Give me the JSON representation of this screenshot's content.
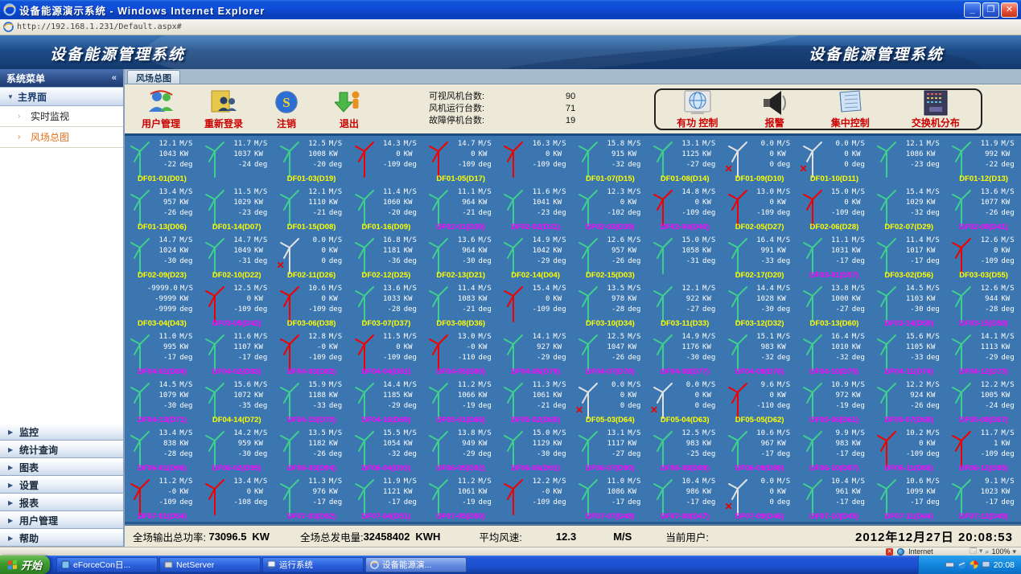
{
  "window": {
    "title": "设备能源演示系统 - Windows Internet Explorer",
    "url": "http://192.168.1.231/Default.aspx#",
    "min_label": "_",
    "restore_label": "❐",
    "close_label": "✕"
  },
  "banner": {
    "title_left": "设备能源管理系统",
    "title_right": "设备能源管理系统"
  },
  "sidebar": {
    "header": "系统菜单",
    "collapse_glyph": "«",
    "main_group": "主界面",
    "sub_items": [
      {
        "label": "实时监视",
        "active": false
      },
      {
        "label": "风场总图",
        "active": true
      }
    ],
    "bottom_items": [
      "监控",
      "统计查询",
      "图表",
      "设置",
      "报表",
      "用户管理",
      "帮助"
    ]
  },
  "tab": "风场总图",
  "toolbar": {
    "buttons": [
      {
        "label": "用户管理",
        "icon": "user-management-icon"
      },
      {
        "label": "重新登录",
        "icon": "relogin-icon"
      },
      {
        "label": "注销",
        "icon": "logoff-icon"
      },
      {
        "label": "退出",
        "icon": "exit-icon"
      }
    ],
    "stats": [
      {
        "label": "可视风机台数:",
        "value": "90"
      },
      {
        "label": "风机运行台数:",
        "value": "71"
      },
      {
        "label": "故障停机台数:",
        "value": "19"
      }
    ],
    "controls": [
      {
        "label": "有功 控制",
        "icon": "active-power-control-icon"
      },
      {
        "label": "报警",
        "icon": "alarm-icon"
      },
      {
        "label": "集中控制",
        "icon": "central-control-icon"
      },
      {
        "label": "交换机分布",
        "icon": "switch-distribution-icon"
      }
    ]
  },
  "turbines": {
    "units": {
      "speed": "M/S",
      "power": "KW",
      "angle": "deg"
    },
    "colors": {
      "run": "#3ecf8e",
      "fault": "#f20000",
      "stop": "#e2e2e2",
      "label_yellow": "#ffff00",
      "label_magenta": "#ff00ff"
    },
    "rows": [
      [
        {
          "s": "12.1",
          "p": "1043",
          "a": "-22",
          "l": "DF01-01(D01)",
          "st": "g",
          "lc": "y"
        },
        {
          "s": "11.7",
          "p": "1037",
          "a": "-24",
          "l": "",
          "st": "g",
          "lc": "h"
        },
        {
          "s": "12.5",
          "p": "1008",
          "a": "-20",
          "l": "DF01-03(D19)",
          "st": "g",
          "lc": "y"
        },
        {
          "s": "14.3",
          "p": "0",
          "a": "-109",
          "l": "",
          "st": "r",
          "lc": "h"
        },
        {
          "s": "14.7",
          "p": "0",
          "a": "-109",
          "l": "DF01-05(D17)",
          "st": "r",
          "lc": "y"
        },
        {
          "s": "16.3",
          "p": "0",
          "a": "-109",
          "l": "",
          "st": "r",
          "lc": "h"
        },
        {
          "s": "15.8",
          "p": "915",
          "a": "-32",
          "l": "DF01-07(D15)",
          "st": "g",
          "lc": "y"
        },
        {
          "s": "13.1",
          "p": "1125",
          "a": "-27",
          "l": "DF01-08(D14)",
          "st": "g",
          "lc": "y"
        },
        {
          "s": "0.0",
          "p": "0",
          "a": "0",
          "l": "DF01-09(D10)",
          "st": "w",
          "lc": "y"
        },
        {
          "s": "0.0",
          "p": "0",
          "a": "0",
          "l": "DF01-10(D11)",
          "st": "w",
          "lc": "y"
        },
        {
          "s": "12.1",
          "p": "1086",
          "a": "-23",
          "l": "",
          "st": "g",
          "lc": "h"
        },
        {
          "s": "11.9",
          "p": "992",
          "a": "-22",
          "l": "DF01-12(D13)",
          "st": "g",
          "lc": "y"
        }
      ],
      [
        {
          "s": "13.4",
          "p": "957",
          "a": "-26",
          "l": "DF01-13(D06)",
          "st": "g",
          "lc": "y"
        },
        {
          "s": "11.5",
          "p": "1029",
          "a": "-23",
          "l": "DF01-14(D07)",
          "st": "g",
          "lc": "y"
        },
        {
          "s": "12.1",
          "p": "1110",
          "a": "-21",
          "l": "DF01-15(D08)",
          "st": "g",
          "lc": "y"
        },
        {
          "s": "11.4",
          "p": "1060",
          "a": "-20",
          "l": "DF01-16(D09)",
          "st": "g",
          "lc": "y"
        },
        {
          "s": "11.1",
          "p": "964",
          "a": "-21",
          "l": "DF02-01(D30)",
          "st": "g",
          "lc": "m"
        },
        {
          "s": "11.6",
          "p": "1041",
          "a": "-23",
          "l": "DF02-02(D31)",
          "st": "g",
          "lc": "m"
        },
        {
          "s": "12.3",
          "p": "0",
          "a": "-102",
          "l": "DF02-03(D39)",
          "st": "g",
          "lc": "m"
        },
        {
          "s": "14.8",
          "p": "0",
          "a": "-109",
          "l": "DF02-04(D40)",
          "st": "r",
          "lc": "m"
        },
        {
          "s": "13.0",
          "p": "0",
          "a": "-109",
          "l": "DF02-05(D27)",
          "st": "r",
          "lc": "y"
        },
        {
          "s": "15.0",
          "p": "0",
          "a": "-109",
          "l": "DF02-06(D28)",
          "st": "r",
          "lc": "y"
        },
        {
          "s": "15.4",
          "p": "1029",
          "a": "-32",
          "l": "DF02-07(D29)",
          "st": "g",
          "lc": "y"
        },
        {
          "s": "13.6",
          "p": "1077",
          "a": "-26",
          "l": "DF02-08(D41)",
          "st": "g",
          "lc": "m"
        }
      ],
      [
        {
          "s": "14.7",
          "p": "1024",
          "a": "-30",
          "l": "DF02-09(D23)",
          "st": "g",
          "lc": "y"
        },
        {
          "s": "14.7",
          "p": "1049",
          "a": "-31",
          "l": "DF02-10(D22)",
          "st": "g",
          "lc": "y"
        },
        {
          "s": "0.0",
          "p": "0",
          "a": "0",
          "l": "DF02-11(D26)",
          "st": "w",
          "lc": "y"
        },
        {
          "s": "16.8",
          "p": "1181",
          "a": "-36",
          "l": "DF02-12(D25)",
          "st": "g",
          "lc": "y"
        },
        {
          "s": "13.6",
          "p": "964",
          "a": "-30",
          "l": "DF02-13(D21)",
          "st": "g",
          "lc": "y"
        },
        {
          "s": "14.9",
          "p": "1042",
          "a": "-29",
          "l": "DF02-14(D04)",
          "st": "g",
          "lc": "y"
        },
        {
          "s": "12.6",
          "p": "957",
          "a": "-26",
          "l": "DF02-15(D03)",
          "st": "g",
          "lc": "y"
        },
        {
          "s": "15.0",
          "p": "1058",
          "a": "-31",
          "l": "",
          "st": "g",
          "lc": "h"
        },
        {
          "s": "16.4",
          "p": "991",
          "a": "-33",
          "l": "DF02-17(D20)",
          "st": "g",
          "lc": "y"
        },
        {
          "s": "11.1",
          "p": "1031",
          "a": "-17",
          "l": "DF03-01(D57)",
          "st": "g",
          "lc": "m"
        },
        {
          "s": "11.4",
          "p": "1017",
          "a": "-17",
          "l": "DF03-02(D56)",
          "st": "g",
          "lc": "y"
        },
        {
          "s": "12.6",
          "p": "0",
          "a": "-109",
          "l": "DF03-03(D55)",
          "st": "r",
          "lc": "y"
        }
      ],
      [
        {
          "s": "-9999.0",
          "p": "-9999",
          "a": "-9999",
          "l": "DF03-04(D43)",
          "st": "n",
          "lc": "y"
        },
        {
          "s": "12.5",
          "p": "0",
          "a": "-109",
          "l": "DF03-05(D42)",
          "st": "r",
          "lc": "m"
        },
        {
          "s": "10.6",
          "p": "0",
          "a": "-109",
          "l": "DF03-06(D38)",
          "st": "r",
          "lc": "y"
        },
        {
          "s": "13.6",
          "p": "1033",
          "a": "-28",
          "l": "DF03-07(D37)",
          "st": "g",
          "lc": "y"
        },
        {
          "s": "11.4",
          "p": "1083",
          "a": "-21",
          "l": "DF03-08(D36)",
          "st": "g",
          "lc": "y"
        },
        {
          "s": "15.4",
          "p": "0",
          "a": "-109",
          "l": "",
          "st": "r",
          "lc": "h"
        },
        {
          "s": "13.5",
          "p": "978",
          "a": "-28",
          "l": "DF03-10(D34)",
          "st": "g",
          "lc": "y"
        },
        {
          "s": "12.1",
          "p": "922",
          "a": "-27",
          "l": "DF03-11(D33)",
          "st": "g",
          "lc": "y"
        },
        {
          "s": "14.4",
          "p": "1028",
          "a": "-30",
          "l": "DF03-12(D32)",
          "st": "g",
          "lc": "y"
        },
        {
          "s": "13.8",
          "p": "1000",
          "a": "-27",
          "l": "DF03-13(D60)",
          "st": "g",
          "lc": "y"
        },
        {
          "s": "14.5",
          "p": "1103",
          "a": "-30",
          "l": "DF03-14(D59)",
          "st": "g",
          "lc": "m"
        },
        {
          "s": "12.6",
          "p": "944",
          "a": "-28",
          "l": "DF03-15(D58)",
          "st": "g",
          "lc": "m"
        }
      ],
      [
        {
          "s": "11.0",
          "p": "995",
          "a": "-17",
          "l": "DF04-01(D84)",
          "st": "g",
          "lc": "m"
        },
        {
          "s": "11.6",
          "p": "1107",
          "a": "-17",
          "l": "DF04-02(D83)",
          "st": "g",
          "lc": "m"
        },
        {
          "s": "12.8",
          "p": "-0",
          "a": "-109",
          "l": "DF04-03(D82)",
          "st": "r",
          "lc": "m"
        },
        {
          "s": "11.5",
          "p": "0",
          "a": "-109",
          "l": "DF04-04(D81)",
          "st": "r",
          "lc": "m"
        },
        {
          "s": "13.0",
          "p": "-0",
          "a": "-110",
          "l": "DF04-05(D80)",
          "st": "r",
          "lc": "m"
        },
        {
          "s": "14.1",
          "p": "927",
          "a": "-29",
          "l": "DF04-06(D79)",
          "st": "g",
          "lc": "m"
        },
        {
          "s": "12.5",
          "p": "1047",
          "a": "-26",
          "l": "DF04-07(D78)",
          "st": "g",
          "lc": "m"
        },
        {
          "s": "14.9",
          "p": "1176",
          "a": "-30",
          "l": "DF04-08(D77)",
          "st": "g",
          "lc": "m"
        },
        {
          "s": "15.1",
          "p": "983",
          "a": "-32",
          "l": "DF04-09(D76)",
          "st": "g",
          "lc": "m"
        },
        {
          "s": "16.4",
          "p": "1010",
          "a": "-32",
          "l": "DF04-10(D75)",
          "st": "g",
          "lc": "m"
        },
        {
          "s": "15.6",
          "p": "1105",
          "a": "-33",
          "l": "DF04-11(D74)",
          "st": "g",
          "lc": "m"
        },
        {
          "s": "14.1",
          "p": "1113",
          "a": "-29",
          "l": "DF04-12(D73)",
          "st": "g",
          "lc": "m"
        }
      ],
      [
        {
          "s": "14.5",
          "p": "1079",
          "a": "-30",
          "l": "DF04-13(D71)",
          "st": "g",
          "lc": "m"
        },
        {
          "s": "15.6",
          "p": "1072",
          "a": "-35",
          "l": "DF04-14(D72)",
          "st": "g",
          "lc": "y"
        },
        {
          "s": "15.9",
          "p": "1188",
          "a": "-33",
          "l": "DF04-15(D70)",
          "st": "g",
          "lc": "m"
        },
        {
          "s": "14.4",
          "p": "1185",
          "a": "-29",
          "l": "DF04-16(D69)",
          "st": "g",
          "lc": "m"
        },
        {
          "s": "11.2",
          "p": "1066",
          "a": "-19",
          "l": "DF05-01(D66)",
          "st": "g",
          "lc": "m"
        },
        {
          "s": "11.3",
          "p": "1061",
          "a": "-21",
          "l": "DF05-02(D65)",
          "st": "g",
          "lc": "m"
        },
        {
          "s": "0.0",
          "p": "0",
          "a": "0",
          "l": "DF05-03(D64)",
          "st": "w",
          "lc": "y"
        },
        {
          "s": "0.0",
          "p": "0",
          "a": "0",
          "l": "DF05-04(D63)",
          "st": "w",
          "lc": "y"
        },
        {
          "s": "9.6",
          "p": "0",
          "a": "-110",
          "l": "DF05-05(D62)",
          "st": "r",
          "lc": "y"
        },
        {
          "s": "10.9",
          "p": "972",
          "a": "-19",
          "l": "DF05-06(D61)",
          "st": "g",
          "lc": "m"
        },
        {
          "s": "12.2",
          "p": "924",
          "a": "-26",
          "l": "DF05-07(D68)",
          "st": "g",
          "lc": "m"
        },
        {
          "s": "12.2",
          "p": "1005",
          "a": "-24",
          "l": "DF05-08(D67)",
          "st": "g",
          "lc": "m"
        }
      ],
      [
        {
          "s": "13.4",
          "p": "838",
          "a": "-28",
          "l": "DF06-01(D96)",
          "st": "g",
          "lc": "m"
        },
        {
          "s": "14.2",
          "p": "959",
          "a": "-30",
          "l": "DF06-02(D95)",
          "st": "g",
          "lc": "m"
        },
        {
          "s": "13.5",
          "p": "1182",
          "a": "-26",
          "l": "DF06-03(D94)",
          "st": "g",
          "lc": "m"
        },
        {
          "s": "15.5",
          "p": "1054",
          "a": "-32",
          "l": "DF06-04(D93)",
          "st": "g",
          "lc": "m"
        },
        {
          "s": "13.8",
          "p": "949",
          "a": "-29",
          "l": "DF06-05(D92)",
          "st": "g",
          "lc": "m"
        },
        {
          "s": "15.0",
          "p": "1129",
          "a": "-30",
          "l": "DF06-06(D91)",
          "st": "g",
          "lc": "m"
        },
        {
          "s": "13.1",
          "p": "1117",
          "a": "-27",
          "l": "DF06-07(D90)",
          "st": "g",
          "lc": "m"
        },
        {
          "s": "12.5",
          "p": "983",
          "a": "-25",
          "l": "DF06-08(D89)",
          "st": "g",
          "lc": "m"
        },
        {
          "s": "10.6",
          "p": "967",
          "a": "-17",
          "l": "DF06-09(D88)",
          "st": "g",
          "lc": "m"
        },
        {
          "s": "9.9",
          "p": "983",
          "a": "-17",
          "l": "DF06-10(D87)",
          "st": "g",
          "lc": "m"
        },
        {
          "s": "10.2",
          "p": "0",
          "a": "-109",
          "l": "DF06-11(D86)",
          "st": "r",
          "lc": "m"
        },
        {
          "s": "11.7",
          "p": "1",
          "a": "-109",
          "l": "DF06-12(D85)",
          "st": "r",
          "lc": "m"
        }
      ],
      [
        {
          "s": "11.2",
          "p": "-0",
          "a": "-109",
          "l": "DF07-01(D54)",
          "st": "r",
          "lc": "m"
        },
        {
          "s": "13.4",
          "p": "0",
          "a": "-108",
          "l": "",
          "st": "r",
          "lc": "h"
        },
        {
          "s": "11.3",
          "p": "976",
          "a": "-17",
          "l": "DF07-03(D52)",
          "st": "g",
          "lc": "m"
        },
        {
          "s": "11.9",
          "p": "1121",
          "a": "-17",
          "l": "DF07-04(D51)",
          "st": "g",
          "lc": "m"
        },
        {
          "s": "11.2",
          "p": "1061",
          "a": "-19",
          "l": "DF07-05(D50)",
          "st": "g",
          "lc": "m"
        },
        {
          "s": "12.2",
          "p": "-0",
          "a": "-109",
          "l": "",
          "st": "r",
          "lc": "h"
        },
        {
          "s": "11.0",
          "p": "1086",
          "a": "-17",
          "l": "DF07-07(D48)",
          "st": "g",
          "lc": "m"
        },
        {
          "s": "10.4",
          "p": "986",
          "a": "-17",
          "l": "DF07-08(D47)",
          "st": "g",
          "lc": "m"
        },
        {
          "s": "0.0",
          "p": "0",
          "a": "0",
          "l": "DF07-09(D46)",
          "st": "w",
          "lc": "m"
        },
        {
          "s": "10.4",
          "p": "961",
          "a": "-17",
          "l": "DF07-10(D45)",
          "st": "g",
          "lc": "m"
        },
        {
          "s": "10.6",
          "p": "1099",
          "a": "-17",
          "l": "DF07-11(D44)",
          "st": "g",
          "lc": "m"
        },
        {
          "s": "9.1",
          "p": "1023",
          "a": "-17",
          "l": "DF07-12(D49)",
          "st": "g",
          "lc": "m"
        }
      ]
    ]
  },
  "statusbar": {
    "total_power_label": "全场输出总功率:",
    "total_power": "73096.5",
    "total_power_unit": "KW",
    "total_energy_label": "全场总发电量:",
    "total_energy": "32458402",
    "total_energy_unit": "KWH",
    "avg_wind_label": "平均风速:",
    "avg_wind": "12.3",
    "avg_wind_unit": "M/S",
    "user_label": "当前用户:",
    "datetime": "2012年12月27日  20:08:53"
  },
  "ie_status": {
    "zone": "Internet",
    "zoom": "100%"
  },
  "taskbar": {
    "start": "开始",
    "tasks": [
      {
        "label": "eForceCon日...",
        "icon": "app-blue",
        "active": false
      },
      {
        "label": "NetServer",
        "icon": "app-gray",
        "active": false
      },
      {
        "label": "运行系统",
        "icon": "app-sys",
        "active": false
      },
      {
        "label": "设备能源演...",
        "icon": "ie",
        "active": true
      }
    ],
    "tray_time": "20:08"
  }
}
